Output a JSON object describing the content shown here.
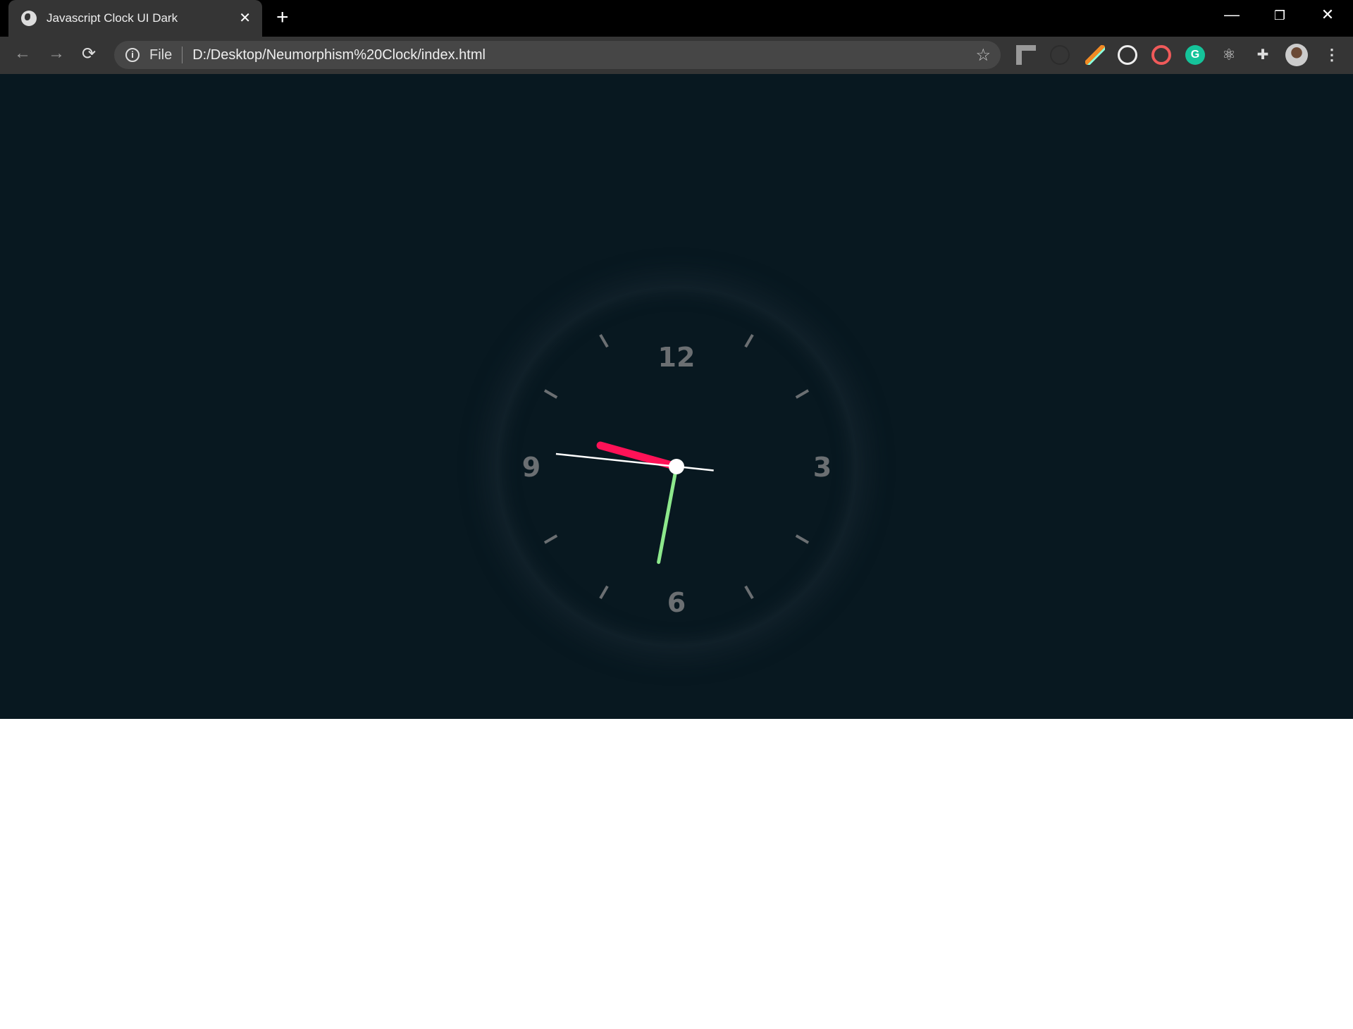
{
  "browser": {
    "tab_title": "Javascript Clock UI Dark",
    "tab_close": "✕",
    "new_tab": "+",
    "omnibox": {
      "scheme_label": "File",
      "url": "D:/Desktop/Neumorphism%20Clock/index.html"
    },
    "extensions": [
      "ruler-icon",
      "hidden-extension-icon",
      "color-picker-icon",
      "speed-gauge-icon",
      "swirl-extension-icon",
      "grammarly-icon",
      "react-devtools-icon",
      "extensions-puzzle-icon",
      "profile-avatar",
      "menu-icon"
    ]
  },
  "clock": {
    "numerals": [
      "12",
      "3",
      "6",
      "9"
    ],
    "time": {
      "hours": 9,
      "minutes": 31,
      "seconds": 46
    },
    "colors": {
      "background": "#081820",
      "hour_hand": "#ff1257",
      "minute_hand": "#8de88c",
      "second_hand": "#ffffff",
      "numerals": "#6b6f72",
      "ticks": "#6b6f72"
    }
  }
}
